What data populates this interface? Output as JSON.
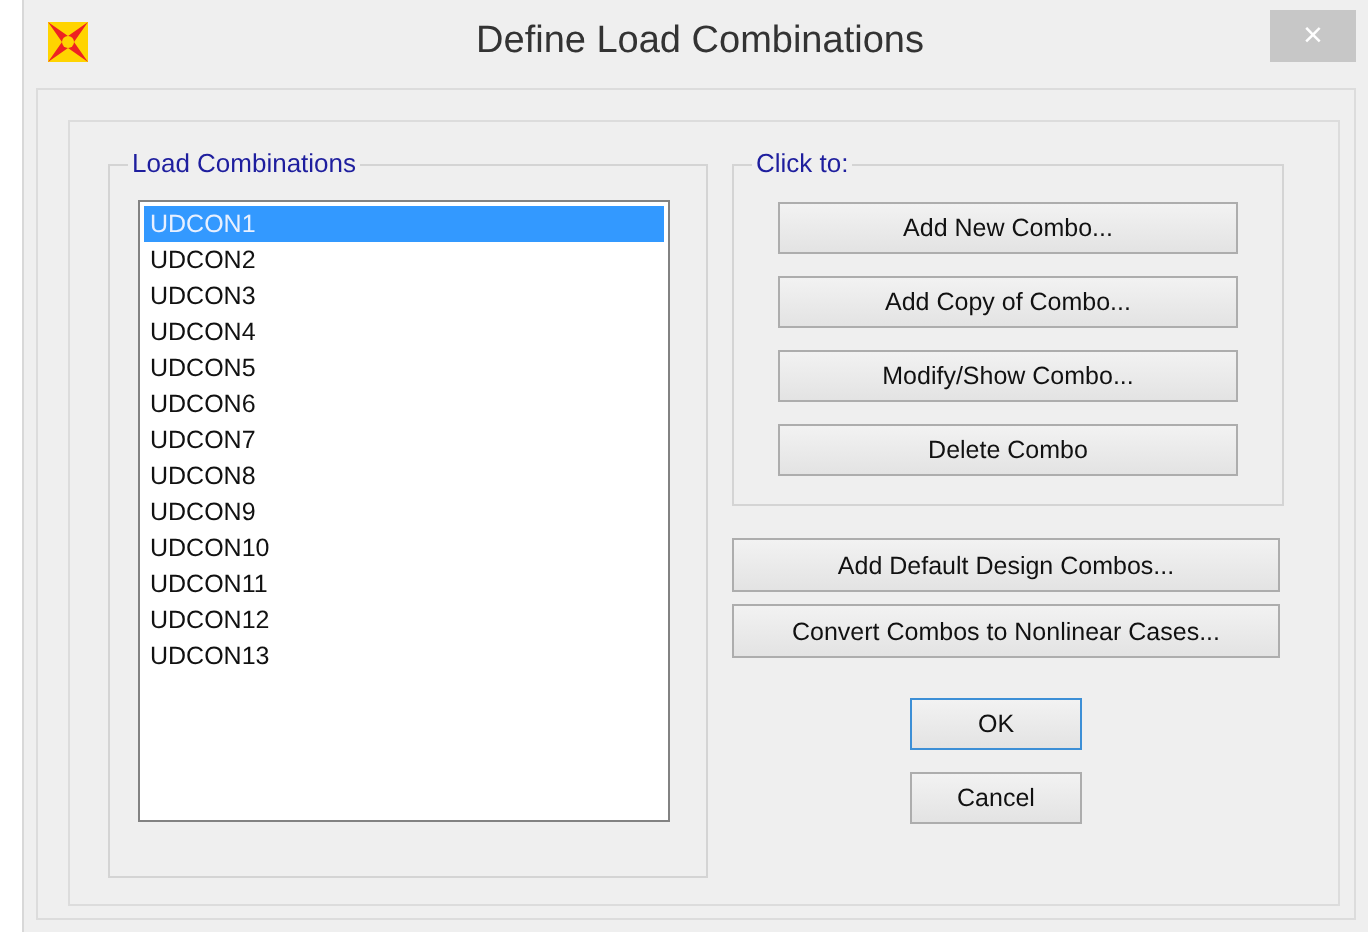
{
  "window": {
    "title": "Define Load Combinations",
    "close_label": "×"
  },
  "load_combinations": {
    "title": "Load Combinations",
    "items": [
      {
        "label": "UDCON1",
        "selected": true
      },
      {
        "label": "UDCON2",
        "selected": false
      },
      {
        "label": "UDCON3",
        "selected": false
      },
      {
        "label": "UDCON4",
        "selected": false
      },
      {
        "label": "UDCON5",
        "selected": false
      },
      {
        "label": "UDCON6",
        "selected": false
      },
      {
        "label": "UDCON7",
        "selected": false
      },
      {
        "label": "UDCON8",
        "selected": false
      },
      {
        "label": "UDCON9",
        "selected": false
      },
      {
        "label": "UDCON10",
        "selected": false
      },
      {
        "label": "UDCON11",
        "selected": false
      },
      {
        "label": "UDCON12",
        "selected": false
      },
      {
        "label": "UDCON13",
        "selected": false
      }
    ]
  },
  "click_to": {
    "title": "Click to:",
    "buttons": [
      "Add New Combo...",
      "Add Copy of Combo...",
      "Modify/Show Combo...",
      "Delete Combo"
    ]
  },
  "extra_buttons": [
    "Add Default Design Combos...",
    "Convert Combos to Nonlinear Cases..."
  ],
  "dialog_buttons": [
    {
      "label": "OK",
      "default": true
    },
    {
      "label": "Cancel",
      "default": false
    }
  ]
}
